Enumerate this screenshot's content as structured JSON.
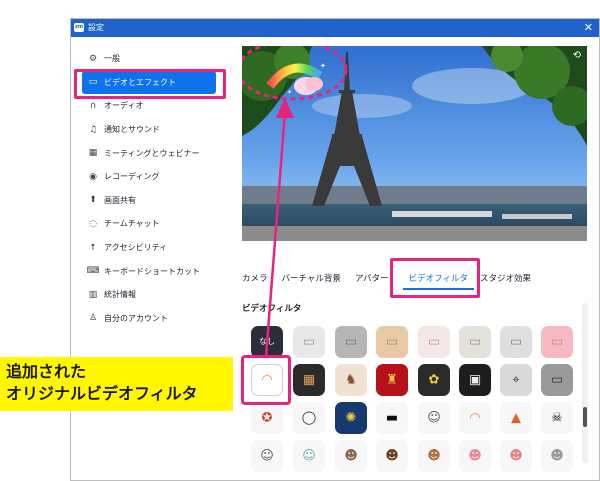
{
  "window": {
    "title": "設定",
    "app_logo": "zoom",
    "close_label": "✕"
  },
  "sidebar": {
    "items": [
      {
        "label": "一般",
        "icon": "gear-icon"
      },
      {
        "label": "ビデオとエフェクト",
        "icon": "video-icon",
        "active": true
      },
      {
        "label": "オーディオ",
        "icon": "headphone-icon"
      },
      {
        "label": "通知とサウンド",
        "icon": "bell-icon"
      },
      {
        "label": "ミーティングとウェビナー",
        "icon": "meeting-icon"
      },
      {
        "label": "レコーディング",
        "icon": "record-icon"
      },
      {
        "label": "画面共有",
        "icon": "share-screen-icon"
      },
      {
        "label": "チームチャット",
        "icon": "chat-icon"
      },
      {
        "label": "アクセシビリティ",
        "icon": "accessibility-icon"
      },
      {
        "label": "キーボードショートカット",
        "icon": "keyboard-icon"
      },
      {
        "label": "統計情報",
        "icon": "stats-icon"
      },
      {
        "label": "自分のアカウント",
        "icon": "account-icon"
      }
    ]
  },
  "tabs": [
    {
      "label": "カメラ"
    },
    {
      "label": "バーチャル背景"
    },
    {
      "label": "アバター"
    },
    {
      "label": "ビデオフィルタ",
      "active": true
    },
    {
      "label": "スタジオ効果"
    }
  ],
  "section": {
    "title": "ビデオフィルタ"
  },
  "filters": {
    "none_label": "なし"
  },
  "annotation": {
    "line1": "追加された",
    "line2": "オリジナルビデオフィルタ",
    "highlight_color": "#e8237e",
    "callout_color": "#fff600"
  },
  "colors": {
    "accent": "#0e72ed",
    "titlebar": "#1f62c9"
  }
}
